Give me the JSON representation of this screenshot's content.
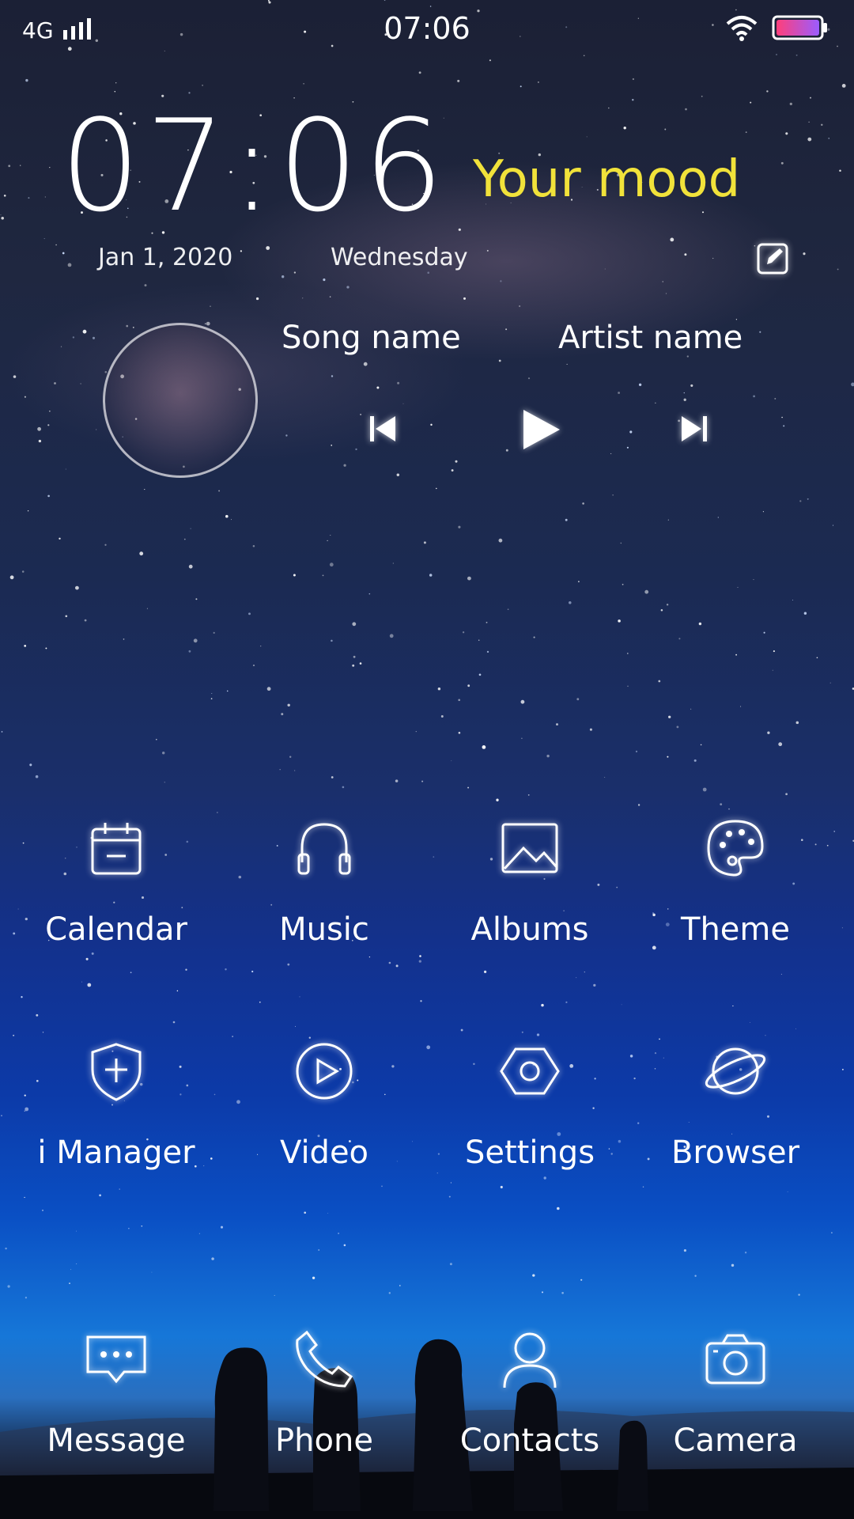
{
  "status_bar": {
    "network": "4G",
    "time": "07:06",
    "signal_icon": "signal-bars-icon",
    "wifi_icon": "wifi-icon",
    "battery_icon": "battery-icon",
    "battery_colors": [
      "#ff3f7a",
      "#9b5cff"
    ]
  },
  "clock_widget": {
    "time": "07:06",
    "date": "Jan 1, 2020",
    "weekday": "Wednesday",
    "mood": "Your mood",
    "mood_color": "#f1e23a",
    "edit_icon": "edit-icon"
  },
  "music_widget": {
    "song_name": "Song name",
    "artist_name": "Artist name",
    "controls": [
      "previous-icon",
      "play-icon",
      "next-icon"
    ]
  },
  "apps": [
    {
      "label": "Calendar",
      "icon": "calendar-icon"
    },
    {
      "label": "Music",
      "icon": "headphones-icon"
    },
    {
      "label": "Albums",
      "icon": "image-icon"
    },
    {
      "label": "Theme",
      "icon": "palette-icon"
    },
    {
      "label": "i Manager",
      "icon": "shield-plus-icon"
    },
    {
      "label": "Video",
      "icon": "play-circle-icon"
    },
    {
      "label": "Settings",
      "icon": "hexagon-gear-icon"
    },
    {
      "label": "Browser",
      "icon": "planet-icon"
    }
  ],
  "dock": [
    {
      "label": "Message",
      "icon": "chat-bubble-icon"
    },
    {
      "label": "Phone",
      "icon": "phone-icon"
    },
    {
      "label": "Contacts",
      "icon": "person-icon"
    },
    {
      "label": "Camera",
      "icon": "camera-icon"
    }
  ]
}
